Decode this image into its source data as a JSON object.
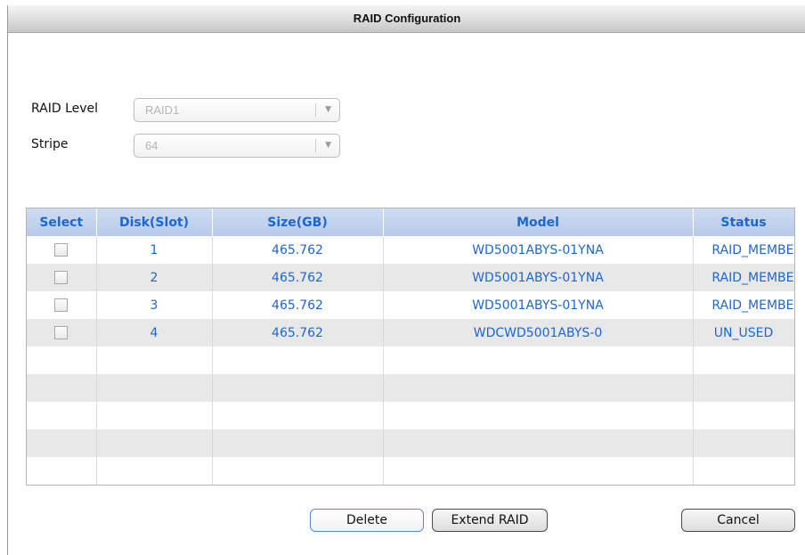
{
  "dialog": {
    "title": "RAID Configuration"
  },
  "form": {
    "raid_level_label": "RAID Level",
    "raid_level_value": "RAID1",
    "stripe_label": "Stripe",
    "stripe_value": "64"
  },
  "table": {
    "columns": [
      "Select",
      "Disk(Slot)",
      "Size(GB)",
      "Model",
      "Status"
    ],
    "rows": [
      {
        "slot": "1",
        "size": "465.762",
        "model": "WD5001ABYS-01YNA",
        "status": "RAID_MEMBE"
      },
      {
        "slot": "2",
        "size": "465.762",
        "model": "WD5001ABYS-01YNA",
        "status": "RAID_MEMBE"
      },
      {
        "slot": "3",
        "size": "465.762",
        "model": "WD5001ABYS-01YNA",
        "status": "RAID_MEMBE"
      },
      {
        "slot": "4",
        "size": "465.762",
        "model": "WDCWD5001ABYS-0",
        "status": "UN_USED"
      }
    ]
  },
  "buttons": {
    "delete": "Delete",
    "extend": "Extend RAID",
    "cancel": "Cancel"
  },
  "colors": {
    "header_text": "#1b67d1",
    "header_bg": "#b7c9ea",
    "row_alt": "#e8e8e8"
  },
  "icons": {
    "dropdown": "chevron-down-icon"
  }
}
